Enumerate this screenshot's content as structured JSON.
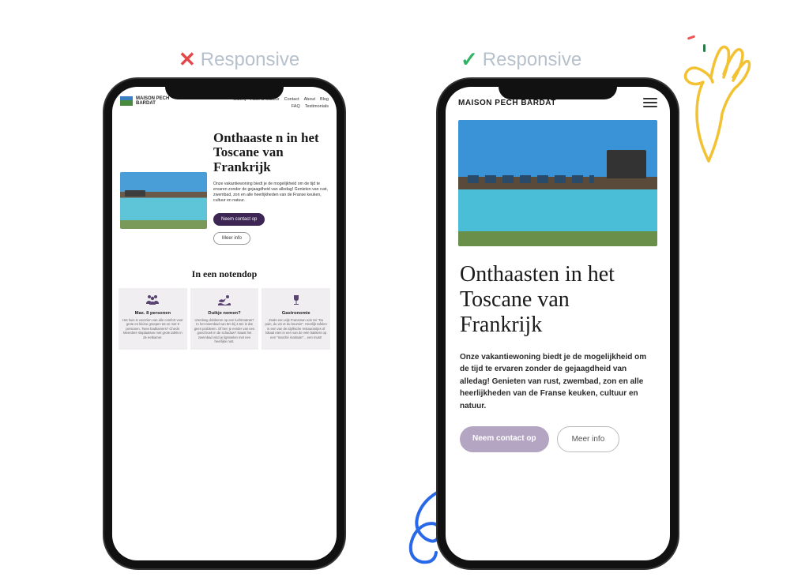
{
  "labels": {
    "left": "Responsive",
    "right": "Responsive"
  },
  "leftPhone": {
    "logo": {
      "line1": "MAISON PECH",
      "line2": "BARDAT"
    },
    "nav": {
      "row1": [
        "Galerij",
        "Actie & Cultuur",
        "Contact",
        "About",
        "Blog"
      ],
      "row2": [
        "FAQ",
        "Testimonials"
      ]
    },
    "hero": {
      "title": "Onthaaste n in het Toscane van Frankrijk",
      "body": "Onze vakantiewoning biedt je de mogelijkheid om de tijd te ervaren zonder de gejaagdheid van alledag! Genieten van rust, zwembad, zon en alle heerlijkheden van de Franse keuken, cultuur en natuur.",
      "primaryBtn": "Neem contact op",
      "secondaryBtn": "Meer info"
    },
    "sectionTitle": "In een notendop",
    "cards": [
      {
        "title": "Max. 8 personen",
        "body": "Het huis is voorzien van alle comfort voor grote en kleine groepen tot en met 8 personen. Twee badkamers? Check! Meerdere slaplaatsen met grote tafels in de eetkamer.",
        "icon": "people-icon"
      },
      {
        "title": "Duikje nemen?",
        "body": "Urenlang dobberen op een luchtmatras? In het zwembad van 8m bij 4.5m is dat geen probleem. Of ben je eerder van een goed boek in de schaduw? Naast het zwembad vind je ligstoelen met een heerlijke rust.",
        "icon": "swimmer-icon"
      },
      {
        "title": "Gastronomie",
        "body": "Zoals een wijs Fransman ooit zei \"Du pain, du vin et du boursin\". Heerlijk tafelen in een van de idyllische restaurantjes of lokaal eten in een van de vele bakkers op een \"marché matinale\"... een must!",
        "icon": "wine-glass-icon"
      }
    ]
  },
  "rightPhone": {
    "logo": "MAISON PECH BARDAT",
    "hero": {
      "title": "Onthaasten in het Toscane van Frankrijk",
      "body": "Onze vakantiewoning biedt je de mogelijkheid om de tijd te ervaren zonder de gejaagdheid van alledag! Genieten van rust, zwembad, zon en alle heerlijkheden van de Franse keuken, cultuur en natuur.",
      "primaryBtn": "Neem contact op",
      "secondaryBtn": "Meer info"
    }
  }
}
